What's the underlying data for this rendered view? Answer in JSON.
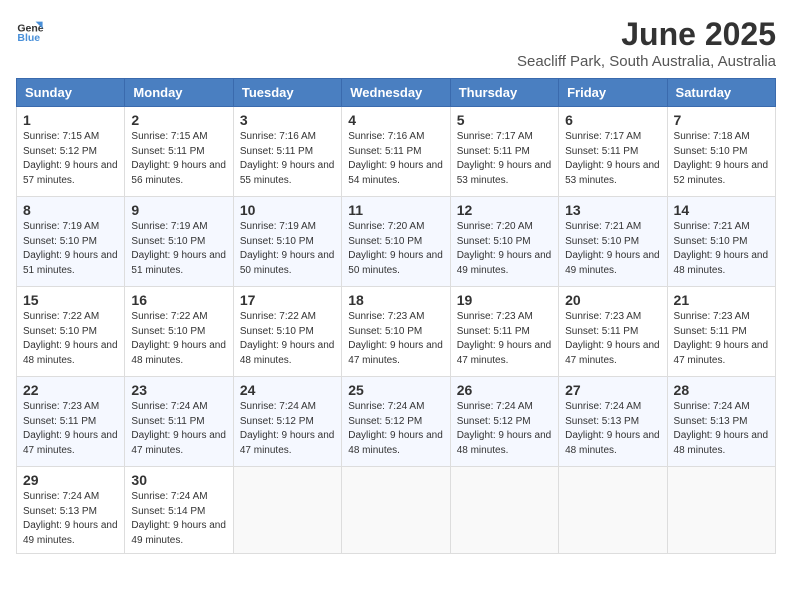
{
  "logo": {
    "general": "General",
    "blue": "Blue"
  },
  "title": "June 2025",
  "location": "Seacliff Park, South Australia, Australia",
  "weekdays": [
    "Sunday",
    "Monday",
    "Tuesday",
    "Wednesday",
    "Thursday",
    "Friday",
    "Saturday"
  ],
  "weeks": [
    [
      {
        "day": "1",
        "sunrise": "7:15 AM",
        "sunset": "5:12 PM",
        "daylight": "9 hours and 57 minutes."
      },
      {
        "day": "2",
        "sunrise": "7:15 AM",
        "sunset": "5:11 PM",
        "daylight": "9 hours and 56 minutes."
      },
      {
        "day": "3",
        "sunrise": "7:16 AM",
        "sunset": "5:11 PM",
        "daylight": "9 hours and 55 minutes."
      },
      {
        "day": "4",
        "sunrise": "7:16 AM",
        "sunset": "5:11 PM",
        "daylight": "9 hours and 54 minutes."
      },
      {
        "day": "5",
        "sunrise": "7:17 AM",
        "sunset": "5:11 PM",
        "daylight": "9 hours and 53 minutes."
      },
      {
        "day": "6",
        "sunrise": "7:17 AM",
        "sunset": "5:11 PM",
        "daylight": "9 hours and 53 minutes."
      },
      {
        "day": "7",
        "sunrise": "7:18 AM",
        "sunset": "5:10 PM",
        "daylight": "9 hours and 52 minutes."
      }
    ],
    [
      {
        "day": "8",
        "sunrise": "7:19 AM",
        "sunset": "5:10 PM",
        "daylight": "9 hours and 51 minutes."
      },
      {
        "day": "9",
        "sunrise": "7:19 AM",
        "sunset": "5:10 PM",
        "daylight": "9 hours and 51 minutes."
      },
      {
        "day": "10",
        "sunrise": "7:19 AM",
        "sunset": "5:10 PM",
        "daylight": "9 hours and 50 minutes."
      },
      {
        "day": "11",
        "sunrise": "7:20 AM",
        "sunset": "5:10 PM",
        "daylight": "9 hours and 50 minutes."
      },
      {
        "day": "12",
        "sunrise": "7:20 AM",
        "sunset": "5:10 PM",
        "daylight": "9 hours and 49 minutes."
      },
      {
        "day": "13",
        "sunrise": "7:21 AM",
        "sunset": "5:10 PM",
        "daylight": "9 hours and 49 minutes."
      },
      {
        "day": "14",
        "sunrise": "7:21 AM",
        "sunset": "5:10 PM",
        "daylight": "9 hours and 48 minutes."
      }
    ],
    [
      {
        "day": "15",
        "sunrise": "7:22 AM",
        "sunset": "5:10 PM",
        "daylight": "9 hours and 48 minutes."
      },
      {
        "day": "16",
        "sunrise": "7:22 AM",
        "sunset": "5:10 PM",
        "daylight": "9 hours and 48 minutes."
      },
      {
        "day": "17",
        "sunrise": "7:22 AM",
        "sunset": "5:10 PM",
        "daylight": "9 hours and 48 minutes."
      },
      {
        "day": "18",
        "sunrise": "7:23 AM",
        "sunset": "5:10 PM",
        "daylight": "9 hours and 47 minutes."
      },
      {
        "day": "19",
        "sunrise": "7:23 AM",
        "sunset": "5:11 PM",
        "daylight": "9 hours and 47 minutes."
      },
      {
        "day": "20",
        "sunrise": "7:23 AM",
        "sunset": "5:11 PM",
        "daylight": "9 hours and 47 minutes."
      },
      {
        "day": "21",
        "sunrise": "7:23 AM",
        "sunset": "5:11 PM",
        "daylight": "9 hours and 47 minutes."
      }
    ],
    [
      {
        "day": "22",
        "sunrise": "7:23 AM",
        "sunset": "5:11 PM",
        "daylight": "9 hours and 47 minutes."
      },
      {
        "day": "23",
        "sunrise": "7:24 AM",
        "sunset": "5:11 PM",
        "daylight": "9 hours and 47 minutes."
      },
      {
        "day": "24",
        "sunrise": "7:24 AM",
        "sunset": "5:12 PM",
        "daylight": "9 hours and 47 minutes."
      },
      {
        "day": "25",
        "sunrise": "7:24 AM",
        "sunset": "5:12 PM",
        "daylight": "9 hours and 48 minutes."
      },
      {
        "day": "26",
        "sunrise": "7:24 AM",
        "sunset": "5:12 PM",
        "daylight": "9 hours and 48 minutes."
      },
      {
        "day": "27",
        "sunrise": "7:24 AM",
        "sunset": "5:13 PM",
        "daylight": "9 hours and 48 minutes."
      },
      {
        "day": "28",
        "sunrise": "7:24 AM",
        "sunset": "5:13 PM",
        "daylight": "9 hours and 48 minutes."
      }
    ],
    [
      {
        "day": "29",
        "sunrise": "7:24 AM",
        "sunset": "5:13 PM",
        "daylight": "9 hours and 49 minutes."
      },
      {
        "day": "30",
        "sunrise": "7:24 AM",
        "sunset": "5:14 PM",
        "daylight": "9 hours and 49 minutes."
      },
      null,
      null,
      null,
      null,
      null
    ]
  ]
}
